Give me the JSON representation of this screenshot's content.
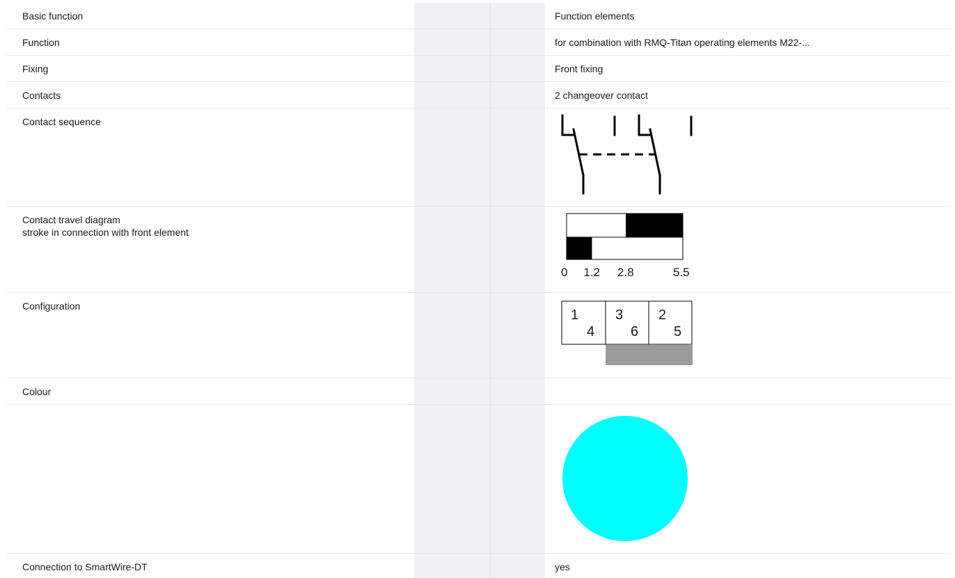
{
  "rows": [
    {
      "label": "Basic function",
      "value": "Function elements"
    },
    {
      "label": "Function",
      "value": "for combination with RMQ-Titan operating elements M22-..."
    },
    {
      "label": "Fixing",
      "value": "Front fixing"
    },
    {
      "label": "Contacts",
      "value": "2 changeover contact"
    },
    {
      "label": "Contact sequence"
    },
    {
      "label": "Contact travel diagram\nstroke in connection with front element"
    },
    {
      "label": "Configuration"
    },
    {
      "label": "Colour"
    },
    {
      "label": ""
    },
    {
      "label": "Connection to SmartWire-DT",
      "value": "yes"
    }
  ],
  "travel_diagram": {
    "ticks": [
      "0",
      "1.2",
      "2.8",
      "5.5"
    ],
    "max_stroke": 5.5,
    "contact_1_closed_from": 2.8,
    "contact_2_closed_until": 1.2
  },
  "configuration": {
    "cells": [
      {
        "top": "1",
        "bottom": "4"
      },
      {
        "top": "3",
        "bottom": "6"
      },
      {
        "top": "2",
        "bottom": "5"
      }
    ]
  },
  "colour": {
    "swatch": "#00ffff",
    "shadow": "#9b9b9b"
  }
}
